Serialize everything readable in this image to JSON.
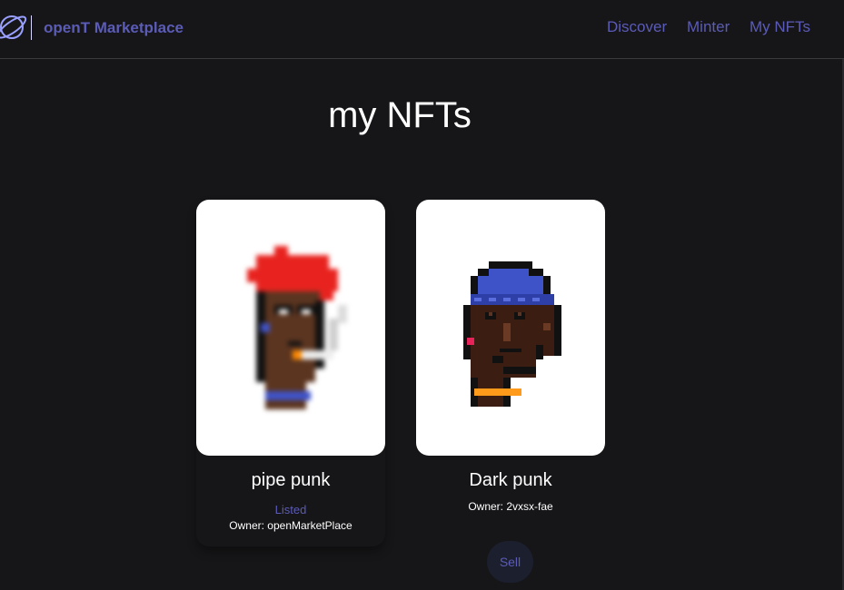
{
  "header": {
    "brand": "openT Marketplace",
    "logo_icon": "planet-icon",
    "nav": {
      "discover": "Discover",
      "minter": "Minter",
      "my_nfts": "My NFTs"
    }
  },
  "main": {
    "title": "my NFTs",
    "nfts": [
      {
        "name": "pipe punk",
        "status": "Listed",
        "owner": "Owner: openMarketPlace",
        "image_icon": "pixel-punk-red-hair-pipe"
      },
      {
        "name": "Dark punk",
        "owner": "Owner: 2vxsx-fae",
        "image_icon": "pixel-punk-blue-beanie"
      }
    ],
    "sell_label": "Sell"
  },
  "colors": {
    "background": "#161618",
    "accent": "#5b5bb8",
    "card": "#ffffff"
  }
}
